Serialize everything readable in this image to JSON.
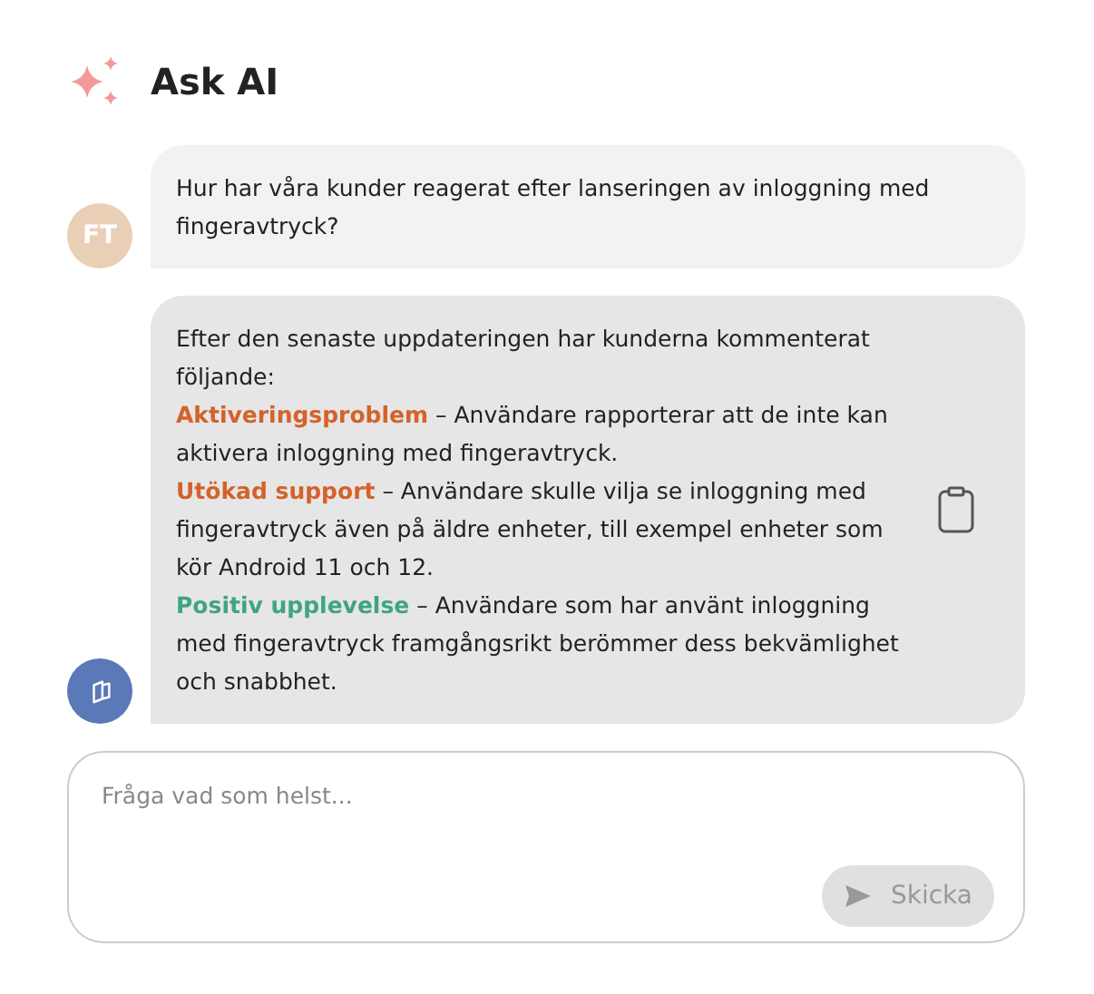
{
  "header": {
    "title": "Ask AI"
  },
  "messages": [
    {
      "kind": "user",
      "avatar": "FT",
      "text": "Hur har våra kunder reagerat efter lanseringen av inloggning med fingeravtryck?"
    },
    {
      "kind": "assistant",
      "intro": "Efter den senaste uppdateringen har kunderna kommenterat följande:",
      "items": [
        {
          "label": "Aktiveringsproblem",
          "text": "– Användare rapporterar att de inte kan aktivera inloggning med fingeravtryck.",
          "color": "#d4622a"
        },
        {
          "label": "Utökad support",
          "text": "– Användare skulle vilja se inloggning med fingeravtryck även på äldre enheter, till exempel enheter som kör Android 11 och 12.",
          "color": "#d4622a"
        },
        {
          "label": "Positiv upplevelse",
          "text": "– Användare som har använt inloggning med fingeravtryck framgångsrikt berömmer dess bekvämlighet och snabbhet.",
          "color": "#3fa57e"
        }
      ]
    }
  ],
  "composer": {
    "placeholder": "Fråga vad som helst...",
    "send_label": "Skicka",
    "send_disabled": true
  }
}
